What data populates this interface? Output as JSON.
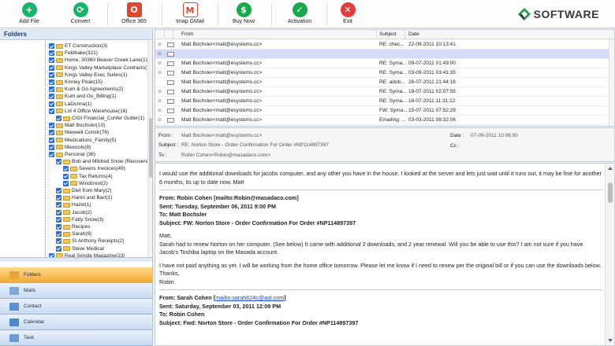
{
  "toolbar": {
    "buttons": [
      {
        "label": "Add File",
        "icon": "add-icon",
        "glyph": "+",
        "color": "#17b46b"
      },
      {
        "label": "Convert",
        "icon": "convert-icon",
        "glyph": "⟳",
        "color": "#17b46b"
      },
      {
        "label": "Office 365",
        "icon": "office-icon",
        "glyph": "O",
        "color": "#e0462d"
      },
      {
        "label": "Imap GMail",
        "icon": "gmail-icon",
        "glyph": "M",
        "color": "#d84a38"
      },
      {
        "label": "Buy Now",
        "icon": "dollar-icon",
        "glyph": "$",
        "color": "#1aa84c"
      },
      {
        "label": "Activation",
        "icon": "check-icon",
        "glyph": "✓",
        "color": "#1aa84c"
      },
      {
        "label": "Exit",
        "icon": "close-icon",
        "glyph": "✕",
        "color": "#e23c3c"
      }
    ],
    "logo_text": "SOFTWARE"
  },
  "folders": {
    "title": "Folders",
    "items": [
      {
        "label": "ET Construction(3)",
        "level": 0
      },
      {
        "label": "Feldhake(321)",
        "level": 0
      },
      {
        "label": "Home, 30360 Beaver Creek Lane(1)",
        "level": 0
      },
      {
        "label": "Kings Valley Marketplace Contracts(1",
        "level": 0
      },
      {
        "label": "Kings Valley Exec Suites(1)",
        "level": 0
      },
      {
        "label": "Kinney Peak(15)",
        "level": 0
      },
      {
        "label": "Kum & Go Agreements(2)",
        "level": 0
      },
      {
        "label": "Kum and Go_Billing(1)",
        "level": 0
      },
      {
        "label": "LaDonna(1)",
        "level": 0
      },
      {
        "label": "Lot 4 Office Warehouse(16)",
        "level": 0
      },
      {
        "label": "CIGI Financial_Confer Gutter(1)",
        "level": 1
      },
      {
        "label": "Matt Bochsler(10)",
        "level": 0
      },
      {
        "label": "Maxwell Constr(78)",
        "level": 0
      },
      {
        "label": "Medications_Family(5)",
        "level": 0
      },
      {
        "label": "Mexicols(8)",
        "level": 0
      },
      {
        "label": "Personal (36)",
        "level": 0
      },
      {
        "label": "Bob and Mildred Snow (Recovere",
        "level": 1
      },
      {
        "label": "Sevens Invoices(49)",
        "level": 2
      },
      {
        "label": "Tax Returns(4)",
        "level": 2
      },
      {
        "label": "Windcrest(2)",
        "level": 2
      },
      {
        "label": "Diet from Mary(2)",
        "level": 1
      },
      {
        "label": "Hanni and Bart(1)",
        "level": 1
      },
      {
        "label": "Hazel(1)",
        "level": 1
      },
      {
        "label": "Jacob(2)",
        "level": 1
      },
      {
        "label": "Fatty Snow(3)",
        "level": 1
      },
      {
        "label": "Recipes",
        "level": 1
      },
      {
        "label": "Sarah(9)",
        "level": 1
      },
      {
        "label": "St Anthony Receipts(2)",
        "level": 1
      },
      {
        "label": "Steve Medical",
        "level": 1
      },
      {
        "label": "Real Simple Magazine(23)",
        "level": 0
      }
    ]
  },
  "nav": [
    {
      "label": "Folders",
      "icon": "folders-icon",
      "color": "#e9a23b",
      "active": true
    },
    {
      "label": "Mails",
      "icon": "mail-icon",
      "color": "#7fa7d9",
      "active": false
    },
    {
      "label": "Contact",
      "icon": "contact-icon",
      "color": "#5b8fcf",
      "active": false
    },
    {
      "label": "Calendar",
      "icon": "calendar-icon",
      "color": "#4d86c9",
      "active": false
    },
    {
      "label": "Task",
      "icon": "task-icon",
      "color": "#6a9ad6",
      "active": false
    }
  ],
  "message_list": {
    "columns": {
      "from": "From",
      "subject": "Subject",
      "date": "Date"
    },
    "rows": [
      {
        "from": "Matt Bochsler<matt@esystems.cc>",
        "subject": "RE: chec...",
        "date": "22-09-2011 10:13:41",
        "attach": true,
        "selected": false
      },
      {
        "from": "",
        "subject": "",
        "date": "",
        "attach": true,
        "selected": true
      },
      {
        "from": "Matt Bochsler<matt@esystems.cc>",
        "subject": "RE: Syma...",
        "date": "09-07-2011 01:49:00",
        "attach": true,
        "selected": false
      },
      {
        "from": "Matt Bochsler<matt@esystems.cc>",
        "subject": "RE: Syma...",
        "date": "03-09-2011 03:41:35",
        "attach": true,
        "selected": false
      },
      {
        "from": "Matt Bochsler<matt@esystems.cc>",
        "subject": "RE: adob...",
        "date": "26-07-2011 21:44:18",
        "attach": false,
        "selected": false
      },
      {
        "from": "Matt Bochsler<matt@esystems.cc>",
        "subject": "RE: Syma...",
        "date": "19-07-2011 02:07:55",
        "attach": true,
        "selected": false
      },
      {
        "from": "Matt Bochsler<matt@esystems.cc>",
        "subject": "RE: Syma...",
        "date": "18-07-2011 11:31:12",
        "attach": true,
        "selected": false
      },
      {
        "from": "Matt Bochsler<matt@esystems.cc>",
        "subject": "FW: Syma...",
        "date": "15-07-2011 07:52:29",
        "attach": true,
        "selected": false
      },
      {
        "from": "Matt Bochsler<matt@esystems.cc>",
        "subject": "Emailing: ...",
        "date": "03-03-2011 08:32:06",
        "attach": true,
        "selected": false
      }
    ]
  },
  "message_header": {
    "from_label": "From :",
    "from_value": "Matt Bochsler<matt@esystems.cc>",
    "subject_label": "Subject :",
    "subject_value": "RE: Norton Store - Order Confirmation For Order #NP114897397",
    "to_label": "To :",
    "to_value": "Robin Cohen<Robin@masadaco.com>",
    "date_label": "Date :",
    "date_value": "07-09-2011 10:06:00",
    "cc_label": "Cc :"
  },
  "body": {
    "intro": "I would use the additional downloads for jacobs computer, and any other you have in the house. I looked at the server and lets just wait until it runs out, it may be fine for another 6 months, its up to date now. Matt",
    "q1_from": "From: Robin Cohen [mailto:Robin@masadaco.com]",
    "q1_sent": "Sent: Tuesday, September 06, 2011 9:00 PM",
    "q1_to": "To: Matt Bochsler",
    "q1_subject": "Subject: FW: Norton Store - Order Confirmation For Order #NP114897397",
    "q1_greet": "Matt,",
    "q1_p1": "Sarah had to renew Norton on her computer.  (See below)  It came with additional 2 downloads, and 2 year renewal.  Will you be able to use this?  I am not sure if you have Jacob's Toshiba laptop on the Masada account.",
    "q1_p2": "I have not paid anything as yet.  I will be working from the home office tomorrow.  Please let me know if I need to renew per the original bill or if you can use the downloads below.",
    "q1_thanks": "Thanks,",
    "q1_sign": "Robin",
    "q2_from_prefix": "From: Sarah Cohen [",
    "q2_from_link": "mailto:sarah624c@aol.com",
    "q2_from_suffix": "]",
    "q2_sent": "Sent: Saturday, September 03, 2011 12:09 PM",
    "q2_to": "To: Robin Cohen",
    "q2_subject": "Subject: Fwd: Norton Store - Order Confirmation For Order #NP114897397"
  }
}
